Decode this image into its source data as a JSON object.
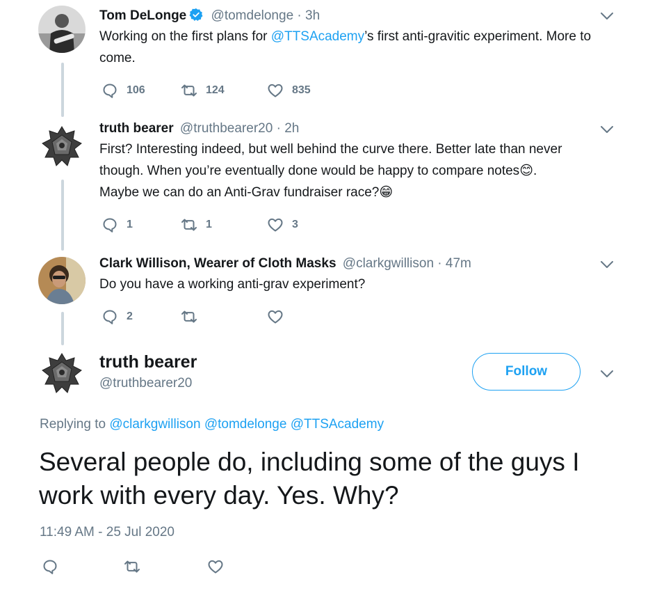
{
  "colors": {
    "accent": "#1da1f2",
    "secondary_text": "#657786",
    "thread_line": "#ccd6dd"
  },
  "tweets": [
    {
      "name": "Tom DeLonge",
      "verified": true,
      "handle": "@tomdelonge",
      "separator": "·",
      "time": "3h",
      "text_before": "Working on the first plans for ",
      "mention": "@TTSAcademy",
      "text_after": "’s first anti-gravitic experiment. More to come.",
      "replies": "106",
      "retweets": "124",
      "likes": "835",
      "icons": {
        "reply": "reply-icon",
        "retweet": "retweet-icon",
        "like": "heart-icon",
        "menu": "chevron-down-icon"
      }
    },
    {
      "name": "truth bearer",
      "handle": "@truthbearer20",
      "separator": "·",
      "time": "2h",
      "line1": "First? Interesting indeed, but well behind the curve there. Better late than never",
      "line2": "though. When you’re eventually done would be happy to compare notes",
      "line2_emoji": "😊",
      "line2_end": ".",
      "line3": "Maybe we can do an Anti-Grav fundraiser race?",
      "line3_emoji": "😁",
      "replies": "1",
      "retweets": "1",
      "likes": "3"
    },
    {
      "name": "Clark Willison, Wearer of Cloth Masks",
      "handle": "@clarkgwillison",
      "separator": "·",
      "time": "47m",
      "text": "Do you have a working anti-grav experiment?",
      "replies": "2"
    }
  ],
  "main_tweet": {
    "name": "truth bearer",
    "handle": "@truthbearer20",
    "follow_label": "Follow",
    "replying_prefix": "Replying to ",
    "replying_mentions": "@clarkgwillison @tomdelonge @TTSAcademy",
    "text": "Several people do, including some of the guys I work with every day. Yes. Why?",
    "timestamp": "11:49 AM - 25 Jul 2020"
  }
}
